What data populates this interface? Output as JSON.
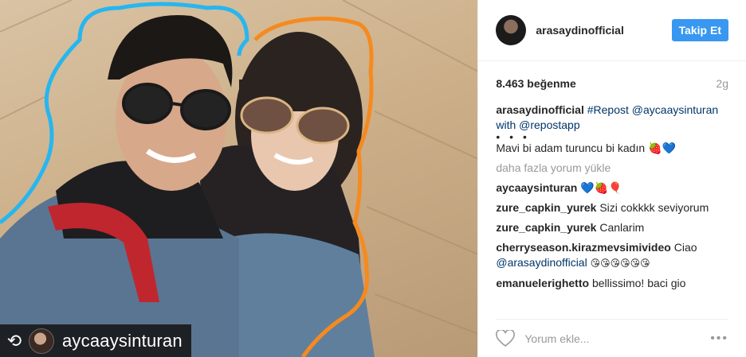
{
  "photo": {
    "repost_username": "aycaaysinturan"
  },
  "header": {
    "username": "arasaydinofficial",
    "follow_label": "Takip Et"
  },
  "stats": {
    "likes": "8.463 beğenme",
    "age": "2g"
  },
  "caption": {
    "user": "arasaydinofficial",
    "text_pre": "#Repost @aycaaysinturan with @repostapp",
    "dots": "• • •",
    "text": "Mavi bi adam turuncu bi kadın 🍓💙"
  },
  "load_more": "daha fazla yorum yükle",
  "comments": [
    {
      "user": "aycaaysinturan",
      "text": "💙🍓🎈"
    },
    {
      "user": "zure_capkin_yurek",
      "text": "Sizi cokkkk seviyorum"
    },
    {
      "user": "zure_capkin_yurek",
      "text": "Canlarim"
    },
    {
      "user": "cherryseason.kirazmevsimivideo",
      "text": "Ciao",
      "mention": "@arasaydinofficial",
      "emoji": "😘😘😘😘😘😘"
    },
    {
      "user": "emanuelerighetto",
      "text": "bellissimo! baci gio"
    }
  ],
  "footer": {
    "placeholder": "Yorum ekle...",
    "more": "•••"
  }
}
